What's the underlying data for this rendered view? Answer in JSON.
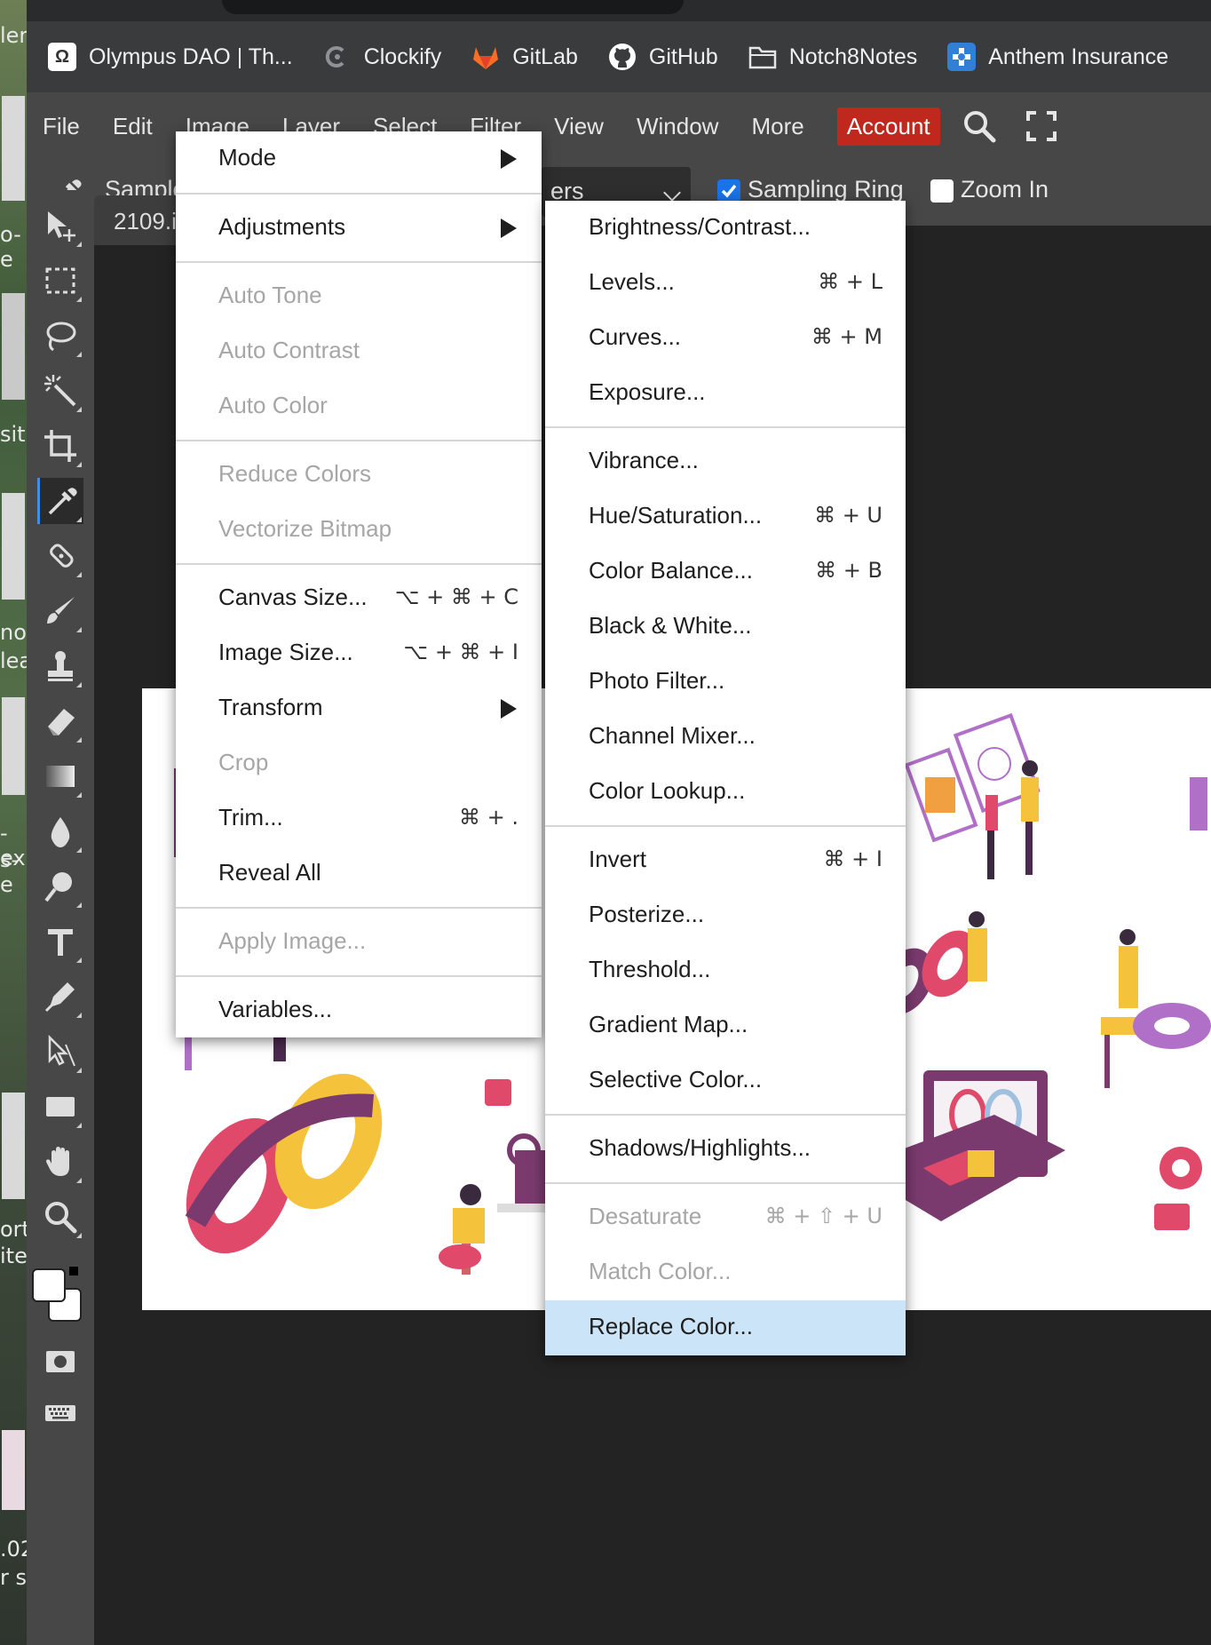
{
  "bookmarks": [
    {
      "label": "Olympus DAO | Th...",
      "icon": "olympus-icon",
      "color": "#ffffff"
    },
    {
      "label": "Clockify",
      "icon": "clockify-icon",
      "color": "#9aa0a6"
    },
    {
      "label": "GitLab",
      "icon": "gitlab-icon",
      "color": "#fc6d26"
    },
    {
      "label": "GitHub",
      "icon": "github-icon",
      "color": "#ffffff"
    },
    {
      "label": "Notch8Notes",
      "icon": "folder-icon",
      "color": "#e6e6e6"
    },
    {
      "label": "Anthem Insurance",
      "icon": "anthem-icon",
      "color": "#2f80d6"
    }
  ],
  "menubar": {
    "items": [
      "File",
      "Edit",
      "Image",
      "Layer",
      "Select",
      "Filter",
      "View",
      "Window",
      "More"
    ],
    "account": "Account",
    "account_color": "#c0281d"
  },
  "options": {
    "sample_label": "Sample",
    "layers_select": "ers",
    "sampling_ring": "Sampling Ring",
    "sampling_ring_checked": true,
    "zoom_in": "Zoom In",
    "zoom_in_checked": false
  },
  "document": {
    "tab": "2109.i"
  },
  "desktop_fragments": [
    "ler",
    "o-e",
    "sit",
    "no",
    "lea",
    "-ex",
    "s-e",
    "ort",
    "ite",
    ".02",
    "r s"
  ],
  "image_menu": [
    {
      "label": "Mode",
      "submenu": true
    },
    {
      "sep": true
    },
    {
      "label": "Adjustments",
      "submenu": true
    },
    {
      "sep": true
    },
    {
      "label": "Auto Tone",
      "disabled": true
    },
    {
      "label": "Auto Contrast",
      "disabled": true
    },
    {
      "label": "Auto Color",
      "disabled": true
    },
    {
      "sep": true
    },
    {
      "label": "Reduce Colors",
      "disabled": true
    },
    {
      "label": "Vectorize Bitmap",
      "disabled": true
    },
    {
      "sep": true
    },
    {
      "label": "Canvas Size...",
      "shortcut": "⌥ + ⌘ + C"
    },
    {
      "label": "Image Size...",
      "shortcut": "⌥ + ⌘ + I"
    },
    {
      "label": "Transform",
      "submenu": true
    },
    {
      "label": "Crop",
      "disabled": true
    },
    {
      "label": "Trim...",
      "shortcut": "⌘ + ."
    },
    {
      "label": "Reveal All"
    },
    {
      "sep": true
    },
    {
      "label": "Apply Image...",
      "disabled": true
    },
    {
      "sep": true
    },
    {
      "label": "Variables..."
    }
  ],
  "adjustments_menu": [
    {
      "label": "Brightness/Contrast..."
    },
    {
      "label": "Levels...",
      "shortcut": "⌘ + L"
    },
    {
      "label": "Curves...",
      "shortcut": "⌘ + M"
    },
    {
      "label": "Exposure..."
    },
    {
      "sep": true
    },
    {
      "label": "Vibrance..."
    },
    {
      "label": "Hue/Saturation...",
      "shortcut": "⌘ + U"
    },
    {
      "label": "Color Balance...",
      "shortcut": "⌘ + B"
    },
    {
      "label": "Black & White..."
    },
    {
      "label": "Photo Filter..."
    },
    {
      "label": "Channel Mixer..."
    },
    {
      "label": "Color Lookup..."
    },
    {
      "sep": true
    },
    {
      "label": "Invert",
      "shortcut": "⌘ + I"
    },
    {
      "label": "Posterize..."
    },
    {
      "label": "Threshold..."
    },
    {
      "label": "Gradient Map..."
    },
    {
      "label": "Selective Color..."
    },
    {
      "sep": true
    },
    {
      "label": "Shadows/Highlights..."
    },
    {
      "sep": true
    },
    {
      "label": "Desaturate",
      "shortcut": "⌘ + ⇧ + U",
      "disabled": true
    },
    {
      "label": "Match Color...",
      "disabled": true
    },
    {
      "label": "Replace Color...",
      "highlighted": true
    }
  ],
  "tools": [
    "move-tool-icon",
    "marquee-tool-icon",
    "lasso-tool-icon",
    "magic-wand-tool-icon",
    "crop-tool-icon",
    "eyedropper-tool-icon",
    "healing-tool-icon",
    "brush-tool-icon",
    "stamp-tool-icon",
    "eraser-tool-icon",
    "gradient-tool-icon",
    "blur-tool-icon",
    "dodge-tool-icon",
    "type-tool-icon",
    "pen-tool-icon",
    "path-select-tool-icon",
    "shape-tool-icon",
    "hand-tool-icon",
    "zoom-tool-icon"
  ]
}
